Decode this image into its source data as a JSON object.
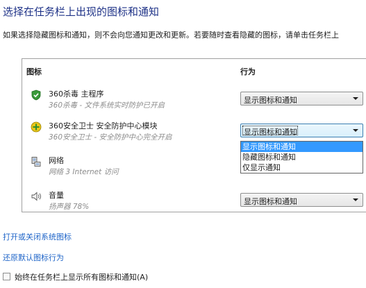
{
  "header": {
    "title": "选择在任务栏上出现的图标和通知",
    "description": "如果选择隐藏图标和通知，则不会向您通知更改和更新。若要随时查看隐藏的图标，请单击任务栏上"
  },
  "table": {
    "col_icon": "图标",
    "col_behavior": "行为",
    "rows": [
      {
        "name": "360杀毒 主程序",
        "description": "360杀毒 - 文件系统实时防护已开启",
        "behavior": "显示图标和通知",
        "icon": "shield-check-icon"
      },
      {
        "name": "360安全卫士 安全防护中心模块",
        "description": "360安全卫士 - 安全防护中心完全开启",
        "behavior": "显示图标和通知",
        "icon": "360-safe-icon"
      },
      {
        "name": "网络",
        "description": "网络 3 Internet 访问",
        "behavior": "",
        "icon": "network-icon"
      },
      {
        "name": "音量",
        "description": "扬声器 78%",
        "behavior": "显示图标和通知",
        "icon": "speaker-icon"
      }
    ]
  },
  "dropdown": {
    "options": [
      "显示图标和通知",
      "隐藏图标和通知",
      "仅显示通知"
    ],
    "selected_index": 0
  },
  "links": {
    "toggle_system_icons": "打开或关闭系统图标",
    "restore_defaults": "还原默认图标行为"
  },
  "checkbox": {
    "label": "始终在任务栏上显示所有图标和通知(A)",
    "checked": false
  },
  "colors": {
    "title": "#1e3287",
    "link": "#1e64c8",
    "selection": "#3399ff"
  }
}
